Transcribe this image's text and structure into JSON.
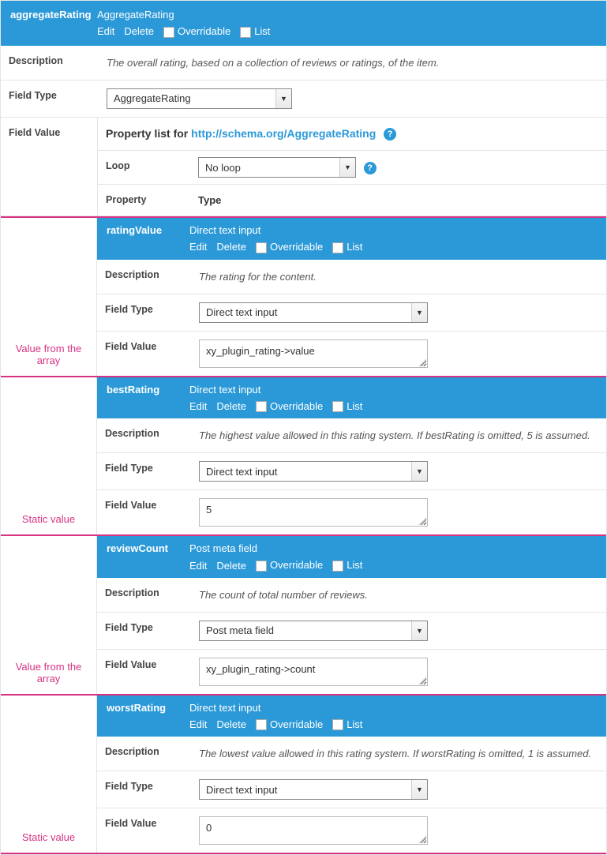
{
  "header": {
    "name": "aggregateRating",
    "type": "AggregateRating",
    "actions": {
      "edit": "Edit",
      "delete": "Delete",
      "overridable": "Overridable",
      "list": "List"
    }
  },
  "labels": {
    "description": "Description",
    "fieldType": "Field Type",
    "fieldValue": "Field Value",
    "property": "Property",
    "type": "Type",
    "loop": "Loop"
  },
  "description": "The overall rating, based on a collection of reviews or ratings, of the item.",
  "fieldTypeSelect": "AggregateRating",
  "propertyList": {
    "prefix": "Property list for ",
    "link": "http://schema.org/AggregateRating",
    "loop": "No loop"
  },
  "notes": {
    "valueFromArray": "Value from the array",
    "staticValue": "Static value"
  },
  "properties": [
    {
      "name": "ratingValue",
      "type": "Direct text input",
      "description": "The rating for the content.",
      "fieldType": "Direct text input",
      "fieldValue": "xy_plugin_rating->value",
      "note": "valueFromArray"
    },
    {
      "name": "bestRating",
      "type": "Direct text input",
      "description": "The highest value allowed in this rating system. If bestRating is omitted, 5 is assumed.",
      "fieldType": "Direct text input",
      "fieldValue": "5",
      "note": "staticValue"
    },
    {
      "name": "reviewCount",
      "type": "Post meta field",
      "description": "The count of total number of reviews.",
      "fieldType": "Post meta field",
      "fieldValue": "xy_plugin_rating->count",
      "note": "valueFromArray"
    },
    {
      "name": "worstRating",
      "type": "Direct text input",
      "description": "The lowest value allowed in this rating system. If worstRating is omitted, 1 is assumed.",
      "fieldType": "Direct text input",
      "fieldValue": "0",
      "note": "staticValue"
    }
  ]
}
